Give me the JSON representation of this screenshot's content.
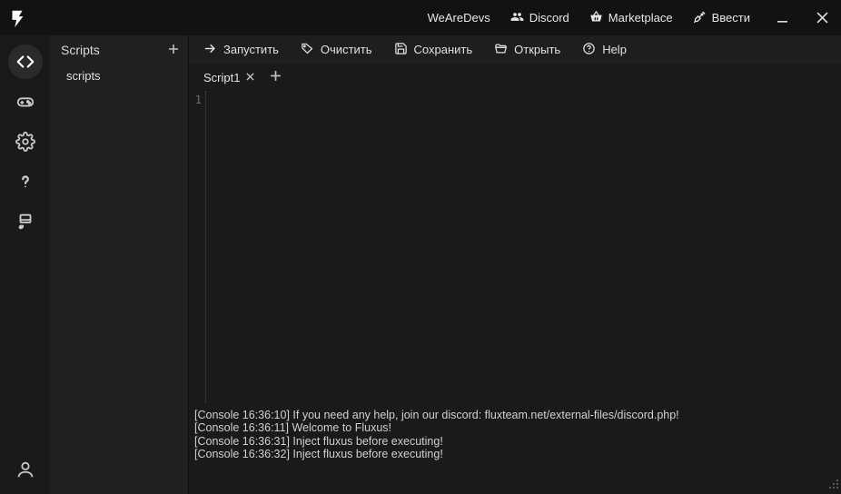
{
  "titlebar": {
    "links": {
      "wearedevs": "WeAreDevs",
      "discord": "Discord",
      "marketplace": "Marketplace",
      "inject": "Ввести"
    }
  },
  "rail": {
    "items": [
      "code",
      "gamepad",
      "settings",
      "help",
      "brush"
    ],
    "bottom": "account"
  },
  "tree": {
    "title": "Scripts",
    "items": [
      "scripts"
    ]
  },
  "toolbar": {
    "run": "Запустить",
    "clear": "Очистить",
    "save": "Сохранить",
    "open": "Открыть",
    "help": "Help"
  },
  "tabs": [
    {
      "label": "Script1",
      "active": true
    }
  ],
  "editor": {
    "line_numbers": [
      "1"
    ],
    "content": ""
  },
  "console": {
    "lines": [
      "[Console 16:36:10] If you need any help, join our discord: fluxteam.net/external-files/discord.php!",
      "[Console 16:36:11] Welcome to Fluxus!",
      "[Console 16:36:31] Inject fluxus before executing!",
      "[Console 16:36:32] Inject fluxus before executing!"
    ]
  }
}
